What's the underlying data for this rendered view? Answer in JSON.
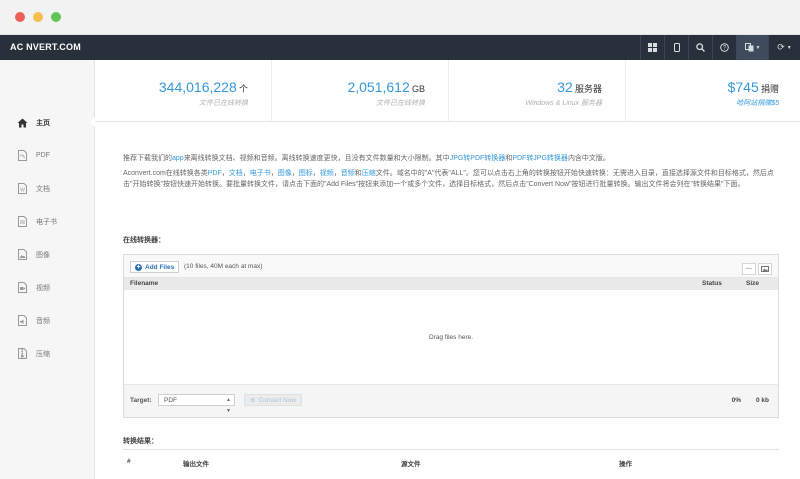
{
  "navbar": {
    "brand": "AC NVERT.COM",
    "buttons": [
      "grid-icon",
      "mobile-icon",
      "search-icon",
      "help-icon",
      "language-icon",
      "refresh-icon"
    ]
  },
  "stats": [
    {
      "number": "344,016,228",
      "unit": "个",
      "sub": "文件已在线转换"
    },
    {
      "number": "2,051,612",
      "unit": "GB",
      "sub": "文件已在线转换"
    },
    {
      "number": "32",
      "unit": "服务器",
      "sub": "Windows & Linux 服务器"
    },
    {
      "number": "$745",
      "unit": "捐赠",
      "sub": "哈阿站捐赠$5"
    }
  ],
  "sidebar": {
    "items": [
      {
        "label": "主页",
        "icon": "home-icon"
      },
      {
        "label": "PDF",
        "icon": "pdf-file-icon"
      },
      {
        "label": "文档",
        "icon": "word-file-icon"
      },
      {
        "label": "电子书",
        "icon": "ebook-file-icon"
      },
      {
        "label": "图像",
        "icon": "image-file-icon"
      },
      {
        "label": "视频",
        "icon": "video-file-icon"
      },
      {
        "label": "音频",
        "icon": "audio-file-icon"
      },
      {
        "label": "压缩",
        "icon": "archive-file-icon"
      }
    ]
  },
  "intro": {
    "p1_a": "推荐下载我们的",
    "p1_app": "app",
    "p1_b": "来离线转换文档、视频和音频。离线转换速度更快，且没有文件数量和大小限制。其中",
    "p1_link1": "JPG转PDF转换器",
    "p1_c": "和",
    "p1_link2": "PDF转JPG转换器",
    "p1_d": "内含中文版。",
    "p2_a": "Aconvert.com在线转换各类",
    "p2_l_pdf": "PDF",
    "p2_l_doc": "文档",
    "p2_l_ebook": "电子书",
    "p2_l_image": "图像",
    "p2_l_icon": "图标",
    "p2_l_video": "视频",
    "p2_l_audio": "音频",
    "p2_and": "和",
    "p2_l_archive": "压缩",
    "p2_b": "文件。域名中的\"A\"代表\"ALL\"。您可以点击右上角的转换按钮开始快速转换：无需进入目录，直接选择源文件和目标格式，然后点击\"开始转换\"按钮快速开始转换。要批量转换文件，请点击下面的\"Add Files\"按钮来添加一个或多个文件，选择目标格式，然后点击\"Convert Now\"按钮进行批量转换。输出文件将会列在\"转换结果\"下面。"
  },
  "online_converter": {
    "title": "在线转换器：",
    "add_files_label": "Add Files",
    "add_files_hint": "(10 files, 40M each at max)",
    "columns": [
      "Filename",
      "Status",
      "Size"
    ],
    "drop_text": "Drag files here.",
    "target_label": "Target:",
    "target_value": "PDF",
    "convert_label": "Convert Now",
    "progress": "0%",
    "total_size": "0 kb"
  },
  "results": {
    "title": "转换结果：",
    "columns": [
      "#",
      "输出文件",
      "源文件",
      "操作"
    ]
  },
  "colors": {
    "accent": "#3498db",
    "navbar": "#28313b",
    "sidebar": "#f6f6f6"
  }
}
